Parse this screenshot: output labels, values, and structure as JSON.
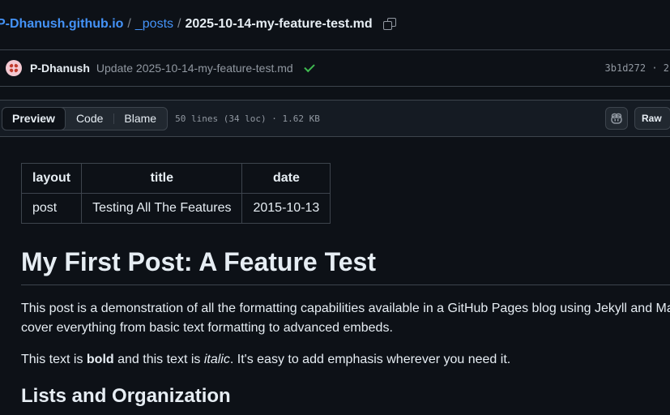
{
  "breadcrumb": {
    "repo": "P-Dhanush.github.io",
    "sep1": "/",
    "dir": "_posts",
    "sep2": "/",
    "file": "2025-10-14-my-feature-test.md"
  },
  "commit": {
    "author": "P-Dhanush",
    "message": "Update 2025-10-14-my-feature-test.md",
    "sha": "3b1d272 · 2",
    "status_icon": "check-icon"
  },
  "toolbar": {
    "tabs": [
      "Preview",
      "Code",
      "Blame"
    ],
    "active_tab": "Preview",
    "file_meta": "50 lines (34 loc) · 1.62 KB",
    "raw_label": "Raw",
    "copilot_icon": "copilot-icon"
  },
  "frontmatter": {
    "headers": [
      "layout",
      "title",
      "date"
    ],
    "row": [
      "post",
      "Testing All The Features",
      "2015-10-13"
    ]
  },
  "content": {
    "title": "My First Post: A Feature Test",
    "p1_line1": "This post is a demonstration of all the formatting capabilities available in a GitHub Pages blog using Jekyll and Ma",
    "p1_line2": "cover everything from basic text formatting to advanced embeds.",
    "p2_a": "This text is ",
    "p2_bold": "bold",
    "p2_b": " and this text is ",
    "p2_italic": "italic",
    "p2_c": ". It's easy to add emphasis wherever you need it.",
    "h2": "Lists and Organization"
  },
  "colors": {
    "background": "#0d1117",
    "link": "#4493f8",
    "success": "#3fb950",
    "border": "#3d444d"
  }
}
